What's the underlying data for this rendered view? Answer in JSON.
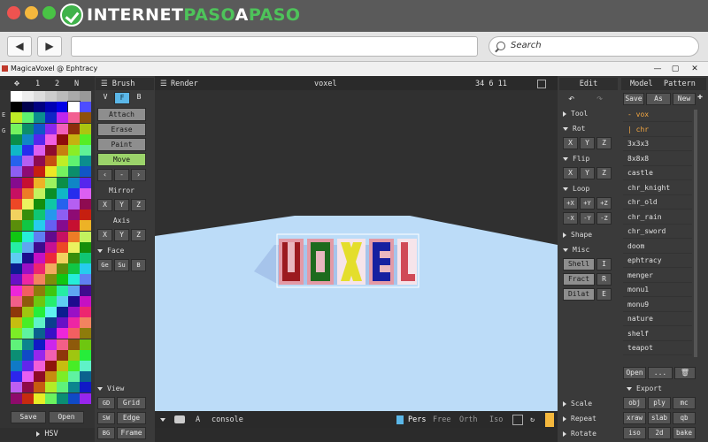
{
  "browser": {
    "logo": {
      "part1": "INTERNET",
      "part2": "PASO",
      "part3": "A",
      "part4": "PASO"
    },
    "back_label": "◀",
    "forward_label": "▶",
    "search_placeholder": "Search",
    "colors": {
      "close": "#ee5350",
      "minimize": "#f5b83d",
      "maximize": "#49c345"
    }
  },
  "app": {
    "title": "MagicaVoxel @ Ephtracy",
    "window_controls": [
      "—",
      "▢",
      "✕"
    ]
  },
  "palette": {
    "tabs": [
      "1",
      "2",
      "N"
    ],
    "side_labels": [
      "E",
      "G"
    ],
    "save_label": "Save",
    "open_label": "Open",
    "hsv_label": "HSV",
    "selected_color": "#ffffff"
  },
  "brush": {
    "header": "Brush",
    "modes": [
      "V",
      "F",
      "B"
    ],
    "actions": [
      "Attach",
      "Erase",
      "Paint",
      "Move"
    ],
    "arrows": [
      "‹",
      "-",
      "›"
    ],
    "mirror_label": "Mirror",
    "mirror_axes": [
      "X",
      "Y",
      "Z"
    ],
    "axis_label": "Axis",
    "axis_axes": [
      "X",
      "Y",
      "Z"
    ],
    "face_label": "Face",
    "face_buttons": [
      "Ge",
      "Su",
      "B"
    ],
    "view_label": "View",
    "view_buttons": [
      [
        "GD",
        "Grid"
      ],
      [
        "SW",
        "Edge"
      ],
      [
        "BG",
        "Frame"
      ]
    ]
  },
  "viewport": {
    "render_label": "Render",
    "title": "voxel",
    "dims": "34  6 11",
    "bottom": {
      "a_label": "A",
      "console_label": "console",
      "modes": [
        "Pers",
        "Free",
        "Orth",
        "Iso"
      ]
    },
    "voxel_text": "VOXEL",
    "colors": {
      "ground": "#bcdcf8",
      "background": "#303030"
    }
  },
  "edit": {
    "header": "Edit",
    "tool_label": "Tool",
    "rot_label": "Rot",
    "rot_axes": [
      "X",
      "Y",
      "Z"
    ],
    "flip_label": "Flip",
    "flip_axes": [
      "X",
      "Y",
      "Z"
    ],
    "loop_label": "Loop",
    "loop_buttons": [
      "+X",
      "+Y",
      "+Z",
      "-X",
      "-Y",
      "-Z"
    ],
    "shape_label": "Shape",
    "misc_label": "Misc",
    "misc_buttons": [
      [
        "Shell",
        "I"
      ],
      [
        "Fract",
        "R"
      ],
      [
        "Dilat",
        "E"
      ]
    ],
    "scale_label": "Scale",
    "repeat_label": "Repeat",
    "rotate_label": "Rotate"
  },
  "model": {
    "tabs": [
      "Model",
      "Pattern"
    ],
    "actions": [
      "Save",
      "As",
      "New"
    ],
    "files": [
      "- vox",
      "| chr",
      "3x3x3",
      "8x8x8",
      "castle",
      "chr_knight",
      "chr_old",
      "chr_rain",
      "chr_sword",
      "doom",
      "ephtracy",
      "menger",
      "monu1",
      "monu9",
      "nature",
      "shelf",
      "teapot"
    ],
    "open_label": "Open",
    "more_label": "...",
    "export_label": "Export",
    "export_buttons": [
      "obj",
      "ply",
      "mc",
      "xraw",
      "slab",
      "qb",
      "iso",
      "2d",
      "bake"
    ]
  }
}
